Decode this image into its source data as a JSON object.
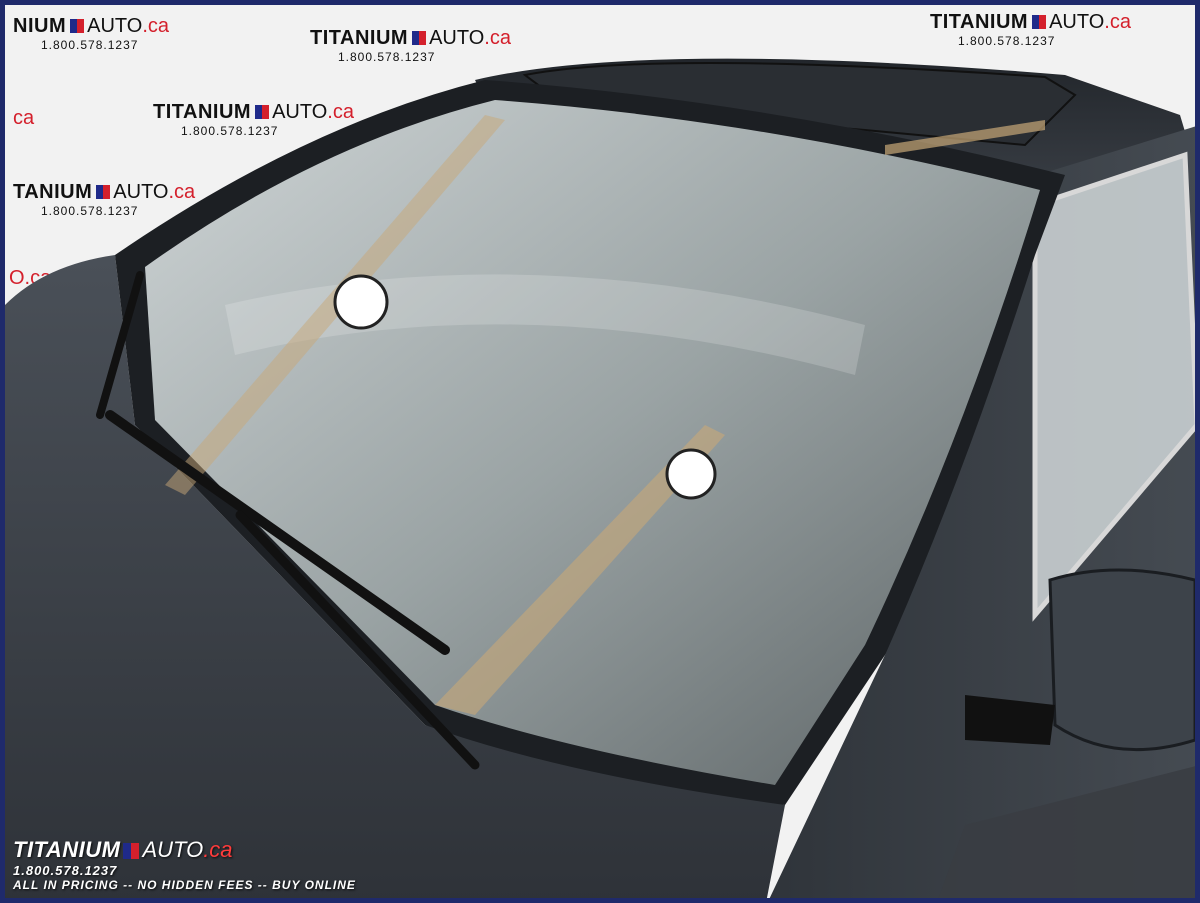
{
  "wall_logos": [
    {
      "brand": "NIUM",
      "auto": "AUTO",
      "ca": ".ca",
      "phone": "1.800.578.1237"
    },
    {
      "brand": "TITANIUM",
      "auto": "AUTO",
      "ca": ".ca",
      "phone": "1.800.578.1237"
    },
    {
      "brand": "TITANIUM",
      "auto": "AUTO",
      "ca": ".ca",
      "phone": "1.800.578.1237"
    },
    {
      "brand": "TITANIUM",
      "auto": "AUTO",
      "ca": ".ca",
      "phone": "1.800.578.1237"
    },
    {
      "brand": "TANIUM",
      "auto": "AUTO",
      "ca": ".ca",
      "phone": "1.800.578.1237"
    }
  ],
  "wall_fragments": {
    "ca_left_1": "ca",
    "ca_left_2": "O.ca"
  },
  "footer": {
    "brand": "TITANIUM",
    "auto": "AUTO",
    "ca": ".ca",
    "phone": "1.800.578.1237",
    "tagline": "ALL IN PRICING  -- NO HIDDEN FEES -- BUY ONLINE"
  },
  "colors": {
    "frame": "#1f2a6b",
    "brand_red": "#d4202c",
    "brand_blue": "#1f2a8a",
    "car_body": "#3a3f47"
  }
}
